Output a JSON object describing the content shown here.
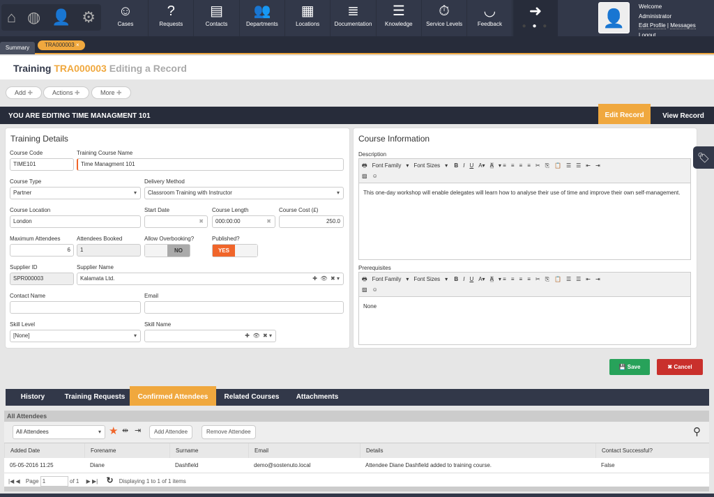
{
  "nav": {
    "quick_icons": [
      "home-icon",
      "globe-icon",
      "user-icon",
      "gears-icon"
    ],
    "items": [
      {
        "label": "Cases",
        "icon": "headset-icon",
        "glyph": "☺"
      },
      {
        "label": "Requests",
        "icon": "question-bubble-icon",
        "glyph": "?"
      },
      {
        "label": "Contacts",
        "icon": "contact-card-icon",
        "glyph": "▤"
      },
      {
        "label": "Departments",
        "icon": "people-icon",
        "glyph": "👥"
      },
      {
        "label": "Locations",
        "icon": "building-icon",
        "glyph": "▦"
      },
      {
        "label": "Documentation",
        "icon": "document-icon",
        "glyph": "≣"
      },
      {
        "label": "Knowledge",
        "icon": "books-icon",
        "glyph": "☰"
      },
      {
        "label": "Service Levels",
        "icon": "stopwatch-icon",
        "glyph": "⏱"
      },
      {
        "label": "Feedback",
        "icon": "feedback-icon",
        "glyph": "◡"
      }
    ]
  },
  "user": {
    "welcome": "Welcome",
    "name": "Administrator",
    "edit_profile": "Edit Profile",
    "separator": "|",
    "messages": "Messages",
    "logout": "Logout"
  },
  "tabs": {
    "summary": "Summary",
    "record": "TRA000003"
  },
  "title": {
    "module": "Training",
    "id": "TRA000003",
    "mode": "Editing a Record"
  },
  "toolbar": {
    "add": "Add",
    "actions": "Actions",
    "more": "More"
  },
  "editbar": {
    "text": "YOU ARE EDITING TIME MANAGMENT 101",
    "edit_record": "Edit Record",
    "view_record": "View Record"
  },
  "details": {
    "title": "Training Details",
    "course_code": {
      "label": "Course Code",
      "value": "TIME101"
    },
    "course_name": {
      "label": "Training Course Name",
      "value": "Time Managment 101"
    },
    "course_type": {
      "label": "Course Type",
      "value": "Partner"
    },
    "delivery": {
      "label": "Delivery Method",
      "value": "Classroom Training with Instructor"
    },
    "location": {
      "label": "Course Location",
      "value": "London"
    },
    "start_date": {
      "label": "Start Date",
      "value": ""
    },
    "length": {
      "label": "Course Length",
      "value": "000:00:00"
    },
    "cost": {
      "label": "Course Cost (£)",
      "value": "250.0"
    },
    "max_att": {
      "label": "Maximum Attendees",
      "value": "6"
    },
    "booked": {
      "label": "Attendees Booked",
      "value": "1"
    },
    "overbooking": {
      "label": "Allow Overbooking?",
      "value": "NO"
    },
    "published": {
      "label": "Published?",
      "value": "YES"
    },
    "supplier_id": {
      "label": "Supplier ID",
      "value": "SPR000003"
    },
    "supplier_name": {
      "label": "Supplier Name",
      "value": "Kalamata Ltd."
    },
    "contact": {
      "label": "Contact Name",
      "value": ""
    },
    "email": {
      "label": "Email",
      "value": ""
    },
    "skill_level": {
      "label": "Skill Level",
      "value": "[None]"
    },
    "skill_name": {
      "label": "Skill Name",
      "value": ""
    }
  },
  "info": {
    "title": "Course Information",
    "font_family": "Font Family",
    "font_sizes": "Font Sizes",
    "description": {
      "label": "Description",
      "value": "This one-day workshop will enable delegates will learn how to analyse their use of time and improve their own self-management."
    },
    "prerequisites": {
      "label": "Prerequisites",
      "value": "None"
    }
  },
  "actions": {
    "save": "Save",
    "cancel": "Cancel",
    "save_color": "#27a25a",
    "cancel_color": "#c9302c"
  },
  "bottom_tabs": [
    "History",
    "Training Requests",
    "Confirmed Attendees",
    "Related Courses",
    "Attachments"
  ],
  "attendees": {
    "title": "All Attendees",
    "filter": "All Attendees",
    "add": "Add Attendee",
    "remove": "Remove Attendee",
    "columns": [
      "Added Date",
      "Forename",
      "Surname",
      "Email",
      "Details",
      "Contact Successful?"
    ],
    "rows": [
      [
        "05-05-2016 11:25",
        "Diane",
        "Dashfield",
        "demo@sostenuto.local",
        "Attendee Diane Dashfield added to training course.",
        "False"
      ]
    ],
    "pager": {
      "page_label": "Page",
      "page": "1",
      "of": "of 1",
      "status": "Displaying 1 to 1 of 1 items"
    }
  },
  "colors": {
    "accent": "#f0a83e",
    "nav": "#323849",
    "published": "#f0652a"
  }
}
